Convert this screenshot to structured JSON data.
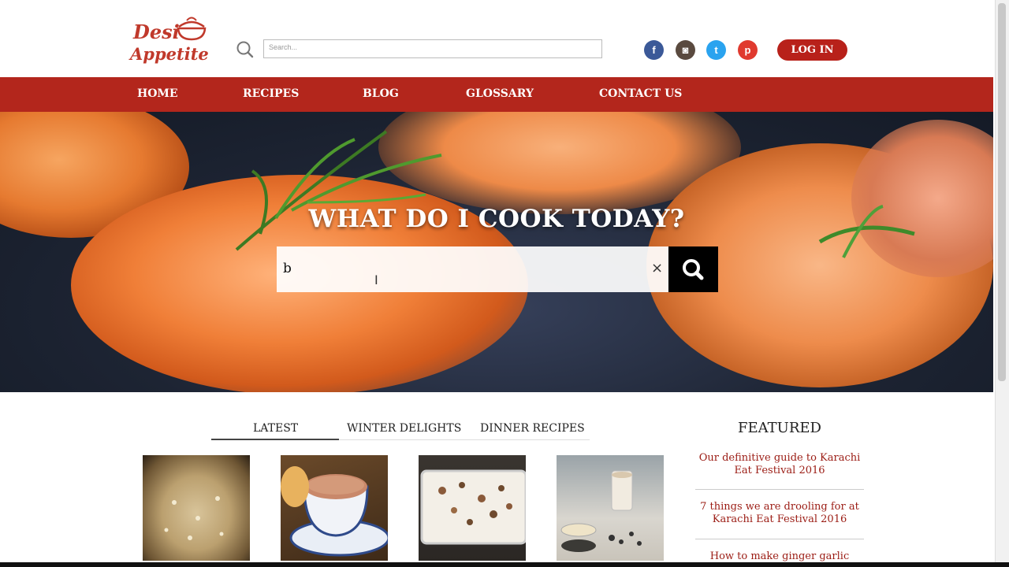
{
  "brand": {
    "line1": "Desi",
    "line2": "Appetite"
  },
  "header": {
    "search_placeholder": "Search...",
    "login_label": "LOG IN",
    "social": [
      {
        "name": "facebook",
        "glyph": "f",
        "color": "#3b5998"
      },
      {
        "name": "instagram",
        "glyph": "◙",
        "color": "#5a4a3f"
      },
      {
        "name": "twitter",
        "glyph": "t",
        "color": "#2aa3ef"
      },
      {
        "name": "pinterest",
        "glyph": "p",
        "color": "#e03a2f"
      }
    ]
  },
  "nav": {
    "items": [
      {
        "label": "HOME"
      },
      {
        "label": "RECIPES"
      },
      {
        "label": "BLOG"
      },
      {
        "label": "GLOSSARY"
      },
      {
        "label": "CONTACT US"
      }
    ]
  },
  "hero": {
    "title": "WHAT DO I COOK TODAY?",
    "search_value": "b",
    "clear_glyph": "×"
  },
  "tabs": [
    {
      "label": "LATEST",
      "active": true
    },
    {
      "label": "WINTER DELIGHTS",
      "active": false
    },
    {
      "label": "DINNER RECIPES",
      "active": false
    }
  ],
  "featured": {
    "title": "FEATURED",
    "items": [
      {
        "text": "Our definitive guide to Karachi Eat Festival 2016"
      },
      {
        "text": "7 things we are drooling for at Karachi Eat Festival 2016"
      },
      {
        "text": "How to make ginger garlic"
      }
    ]
  },
  "colors": {
    "brand_red": "#b3261c",
    "featured_link": "#9b1c14"
  }
}
